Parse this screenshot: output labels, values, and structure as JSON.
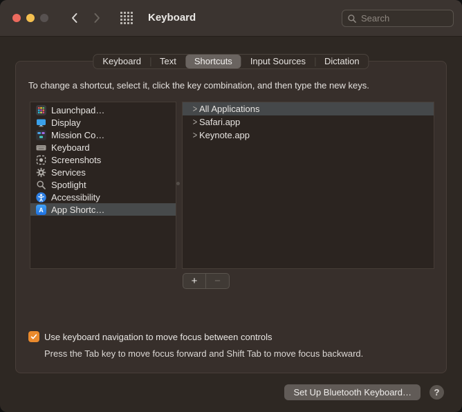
{
  "titlebar": {
    "title": "Keyboard",
    "search": {
      "placeholder": "Search",
      "icon": "magnifier"
    },
    "back_icon": "chevron-left",
    "forward_icon": "chevron-right-disabled",
    "show_all_icon": "grid"
  },
  "window_controls": [
    "close",
    "minimize",
    "zoom-disabled"
  ],
  "tabs": {
    "items": [
      {
        "label": "Keyboard",
        "selected": false
      },
      {
        "label": "Text",
        "selected": false
      },
      {
        "label": "Shortcuts",
        "selected": true
      },
      {
        "label": "Input Sources",
        "selected": false
      },
      {
        "label": "Dictation",
        "selected": false
      }
    ]
  },
  "shortcuts_pane": {
    "instruction": "To change a shortcut, select it, click the key combination, and then type the new keys.",
    "categories": [
      {
        "label": "Launchpad…",
        "icon": "launchpad",
        "selected": false
      },
      {
        "label": "Display",
        "icon": "display",
        "selected": false
      },
      {
        "label": "Mission Co…",
        "icon": "mission-control",
        "selected": false
      },
      {
        "label": "Keyboard",
        "icon": "keyboard",
        "selected": false
      },
      {
        "label": "Screenshots",
        "icon": "screenshots",
        "selected": false
      },
      {
        "label": "Services",
        "icon": "services-gear",
        "selected": false
      },
      {
        "label": "Spotlight",
        "icon": "spotlight-magnifier",
        "selected": false
      },
      {
        "label": "Accessibility",
        "icon": "accessibility",
        "selected": false
      },
      {
        "label": "App Shortc…",
        "icon": "app-shortcuts",
        "selected": true
      }
    ],
    "app_shortcuts": [
      {
        "label": "All Applications",
        "selected": true
      },
      {
        "label": "Safari.app",
        "selected": false
      },
      {
        "label": "Keynote.app",
        "selected": false
      }
    ],
    "add_button": "+",
    "remove_button": "−",
    "keyboard_navigation": {
      "checked": true,
      "label": "Use keyboard navigation to move focus between controls",
      "description": "Press the Tab key to move focus forward and Shift Tab to move focus backward."
    }
  },
  "footer": {
    "setup_bluetooth_label": "Set Up Bluetooth Keyboard…",
    "help_label": "?"
  },
  "colors": {
    "accent_orange": "#EA8A2D",
    "selection_gray": "#45484A",
    "traffic_red": "#EC6A5E",
    "traffic_yellow": "#F4BF4F",
    "traffic_gray": "#575150"
  }
}
